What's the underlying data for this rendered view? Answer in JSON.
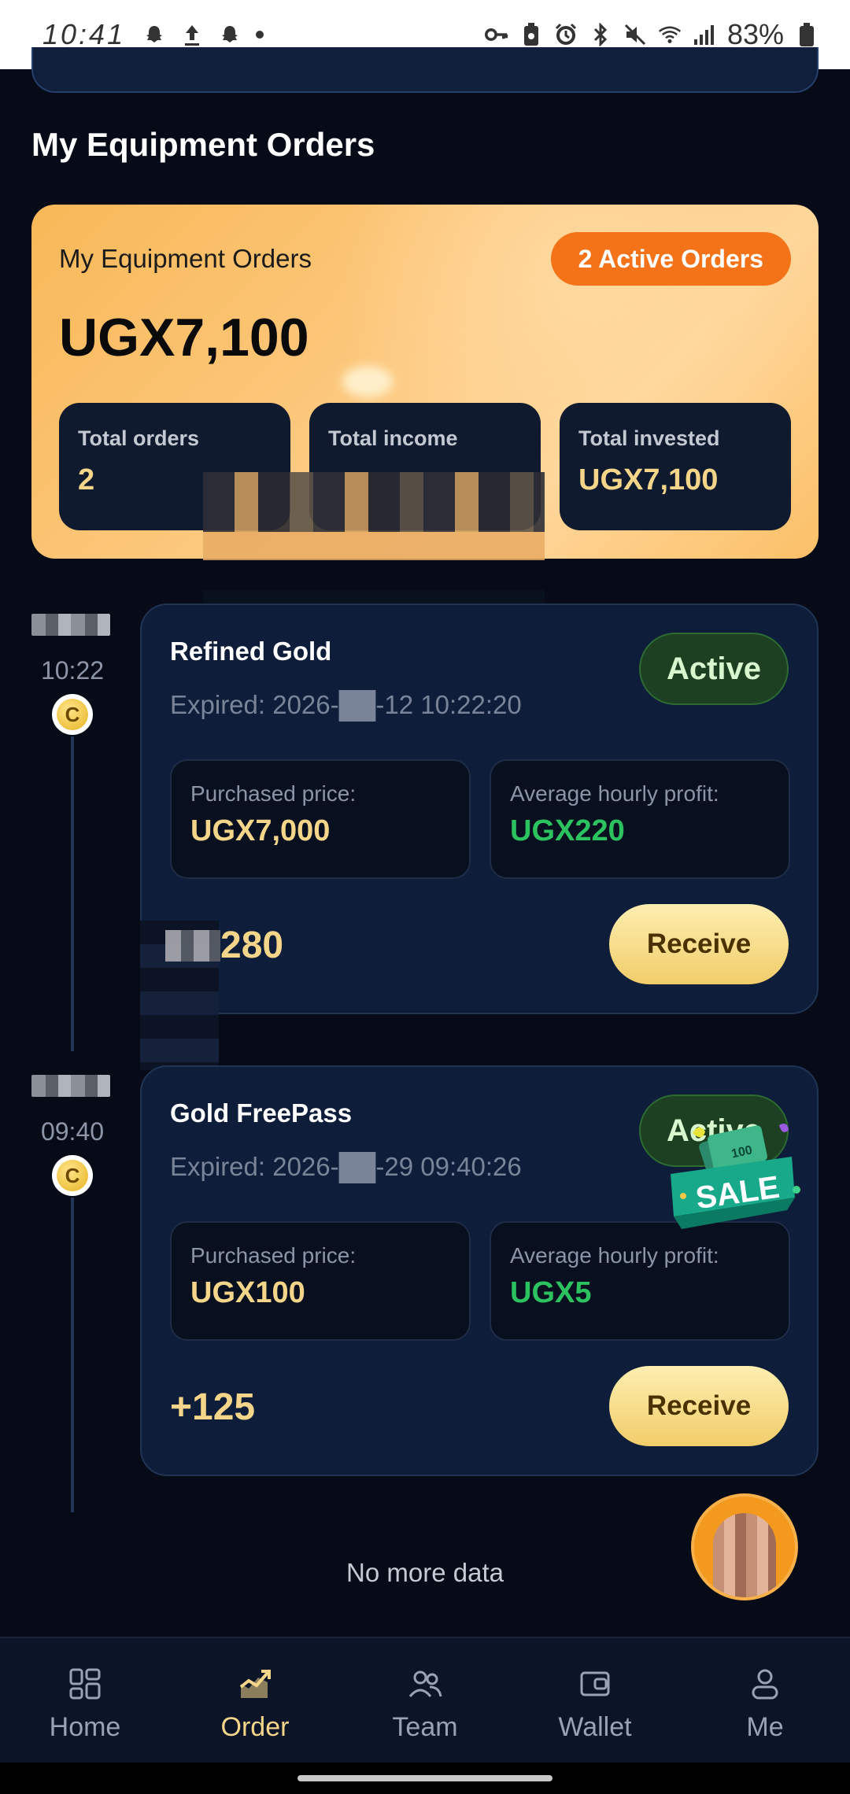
{
  "status_bar": {
    "time": "10:41",
    "battery": "83%",
    "icons": [
      "snapchat-icon",
      "upload-icon",
      "snapchat-icon",
      "dot-icon",
      "key-icon",
      "battery-saver-icon",
      "alarm-icon",
      "bluetooth-icon",
      "mute-icon",
      "wifi-icon",
      "signal-icon",
      "battery-icon"
    ]
  },
  "page": {
    "heading": "My Equipment Orders"
  },
  "summary": {
    "title": "My Equipment Orders",
    "active_badge": "2 Active Orders",
    "amount": "UGX7,100",
    "stats": [
      {
        "label": "Total orders",
        "value": "2"
      },
      {
        "label": "Total income",
        "value": ""
      },
      {
        "label": "Total invested",
        "value": "UGX7,100"
      }
    ]
  },
  "orders": [
    {
      "time": "10:22",
      "name": "Refined Gold",
      "expired": "Expired: 2026-██-12 10:22:20",
      "status": "Active",
      "purchased_label": "Purchased price:",
      "purchased_value": "UGX7,000",
      "hourly_label": "Average hourly profit:",
      "hourly_value": "UGX220",
      "profit": "280",
      "receive_label": "Receive"
    },
    {
      "time": "09:40",
      "name": "Gold FreePass",
      "expired": "Expired: 2026-██-29 09:40:26",
      "status": "Active",
      "purchased_label": "Purchased price:",
      "purchased_value": "UGX100",
      "hourly_label": "Average hourly profit:",
      "hourly_value": "UGX5",
      "profit": "+125",
      "receive_label": "Receive"
    }
  ],
  "sale_badge": {
    "text": "SALE",
    "note_value": "100"
  },
  "footer": {
    "no_more": "No more data"
  },
  "nav": {
    "items": [
      {
        "label": "Home",
        "icon": "home-grid-icon"
      },
      {
        "label": "Order",
        "icon": "order-chart-icon"
      },
      {
        "label": "Team",
        "icon": "team-icon"
      },
      {
        "label": "Wallet",
        "icon": "wallet-icon"
      },
      {
        "label": "Me",
        "icon": "person-icon"
      }
    ],
    "active": "Order"
  },
  "colors": {
    "background": "#060b17",
    "accent_gold": "#f4d58a",
    "badge_orange": "#f47318",
    "profit_green": "#2bc25f",
    "card_bg": "#0e1d3a"
  }
}
